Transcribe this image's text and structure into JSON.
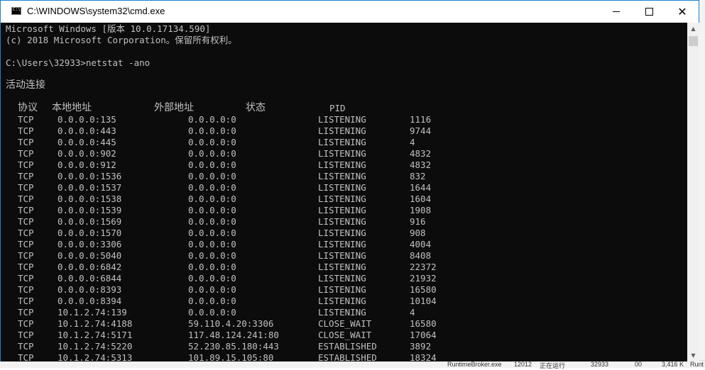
{
  "window": {
    "title": "C:\\WINDOWS\\system32\\cmd.exe",
    "close_glyph": "✕",
    "scroll_up_glyph": "▲",
    "scroll_down_glyph": "▼"
  },
  "console": {
    "header_line1": "Microsoft Windows [版本 10.0.17134.590]",
    "header_line2": "(c) 2018 Microsoft Corporation。保留所有权利。",
    "prompt": "C:\\Users\\32933>netstat -ano",
    "section_title": "活动连接",
    "columns": {
      "proto": "协议",
      "local": "本地地址",
      "foreign": "外部地址",
      "state": "状态",
      "pid": "PID"
    },
    "rows": [
      {
        "proto": "TCP",
        "local": "0.0.0.0:135",
        "foreign": "0.0.0.0:0",
        "state": "LISTENING",
        "pid": "1116"
      },
      {
        "proto": "TCP",
        "local": "0.0.0.0:443",
        "foreign": "0.0.0.0:0",
        "state": "LISTENING",
        "pid": "9744"
      },
      {
        "proto": "TCP",
        "local": "0.0.0.0:445",
        "foreign": "0.0.0.0:0",
        "state": "LISTENING",
        "pid": "4"
      },
      {
        "proto": "TCP",
        "local": "0.0.0.0:902",
        "foreign": "0.0.0.0:0",
        "state": "LISTENING",
        "pid": "4832"
      },
      {
        "proto": "TCP",
        "local": "0.0.0.0:912",
        "foreign": "0.0.0.0:0",
        "state": "LISTENING",
        "pid": "4832"
      },
      {
        "proto": "TCP",
        "local": "0.0.0.0:1536",
        "foreign": "0.0.0.0:0",
        "state": "LISTENING",
        "pid": "832"
      },
      {
        "proto": "TCP",
        "local": "0.0.0.0:1537",
        "foreign": "0.0.0.0:0",
        "state": "LISTENING",
        "pid": "1644"
      },
      {
        "proto": "TCP",
        "local": "0.0.0.0:1538",
        "foreign": "0.0.0.0:0",
        "state": "LISTENING",
        "pid": "1604"
      },
      {
        "proto": "TCP",
        "local": "0.0.0.0:1539",
        "foreign": "0.0.0.0:0",
        "state": "LISTENING",
        "pid": "1908"
      },
      {
        "proto": "TCP",
        "local": "0.0.0.0:1569",
        "foreign": "0.0.0.0:0",
        "state": "LISTENING",
        "pid": "916"
      },
      {
        "proto": "TCP",
        "local": "0.0.0.0:1570",
        "foreign": "0.0.0.0:0",
        "state": "LISTENING",
        "pid": "908"
      },
      {
        "proto": "TCP",
        "local": "0.0.0.0:3306",
        "foreign": "0.0.0.0:0",
        "state": "LISTENING",
        "pid": "4004"
      },
      {
        "proto": "TCP",
        "local": "0.0.0.0:5040",
        "foreign": "0.0.0.0:0",
        "state": "LISTENING",
        "pid": "8408"
      },
      {
        "proto": "TCP",
        "local": "0.0.0.0:6842",
        "foreign": "0.0.0.0:0",
        "state": "LISTENING",
        "pid": "22372"
      },
      {
        "proto": "TCP",
        "local": "0.0.0.0:6844",
        "foreign": "0.0.0.0:0",
        "state": "LISTENING",
        "pid": "21932"
      },
      {
        "proto": "TCP",
        "local": "0.0.0.0:8393",
        "foreign": "0.0.0.0:0",
        "state": "LISTENING",
        "pid": "16580"
      },
      {
        "proto": "TCP",
        "local": "0.0.0.0:8394",
        "foreign": "0.0.0.0:0",
        "state": "LISTENING",
        "pid": "10104"
      },
      {
        "proto": "TCP",
        "local": "10.1.2.74:139",
        "foreign": "0.0.0.0:0",
        "state": "LISTENING",
        "pid": "4"
      },
      {
        "proto": "TCP",
        "local": "10.1.2.74:4188",
        "foreign": "59.110.4.20:3306",
        "state": "CLOSE_WAIT",
        "pid": "16580"
      },
      {
        "proto": "TCP",
        "local": "10.1.2.74:5171",
        "foreign": "117.48.124.241:80",
        "state": "CLOSE_WAIT",
        "pid": "17064"
      },
      {
        "proto": "TCP",
        "local": "10.1.2.74:5220",
        "foreign": "52.230.85.180:443",
        "state": "ESTABLISHED",
        "pid": "3892"
      },
      {
        "proto": "TCP",
        "local": "10.1.2.74:5313",
        "foreign": "101.89.15.105:80",
        "state": "ESTABLISHED",
        "pid": "18324"
      }
    ]
  },
  "background_taskbar": {
    "process_name": "RuntimeBroker.exe",
    "pid": "12012",
    "status": "正在运行",
    "user": "32933",
    "cpu": "00",
    "memory": "3,416 K",
    "extra": "Runt"
  }
}
